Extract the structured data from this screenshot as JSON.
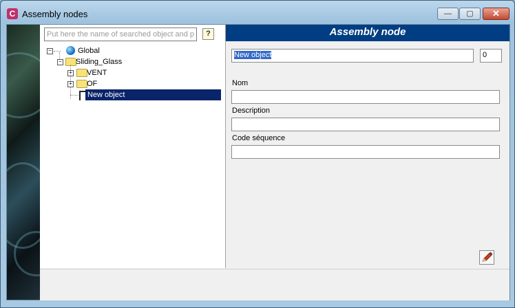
{
  "window": {
    "title": "Assembly nodes",
    "app_icon_letter": "C",
    "minimize_glyph": "—",
    "maximize_glyph": "▢",
    "close_glyph": "✕"
  },
  "search": {
    "placeholder": "Put here the name of searched object and pr",
    "help_glyph": "?"
  },
  "tree": {
    "root": {
      "label": "Global",
      "icon": "globe-icon",
      "expander": "−"
    },
    "child": {
      "label": "Sliding_Glass",
      "icon": "folder-icon",
      "expander": "−"
    },
    "items": [
      {
        "label": "VENT",
        "icon": "folder-icon",
        "expander": "+"
      },
      {
        "label": "OF",
        "icon": "folder-icon",
        "expander": "+"
      },
      {
        "label": "New object",
        "icon": "node-icon",
        "selected": true
      }
    ]
  },
  "form": {
    "header": "Assembly node",
    "name_value": "New object",
    "count_value": "0",
    "nom_label": "Nom",
    "nom_value": "",
    "description_label": "Description",
    "description_value": "",
    "code_label": "Code séquence",
    "code_value": ""
  },
  "colors": {
    "header_bg": "#003d82",
    "selection": "#0a246a",
    "text_selection": "#3169c6"
  }
}
